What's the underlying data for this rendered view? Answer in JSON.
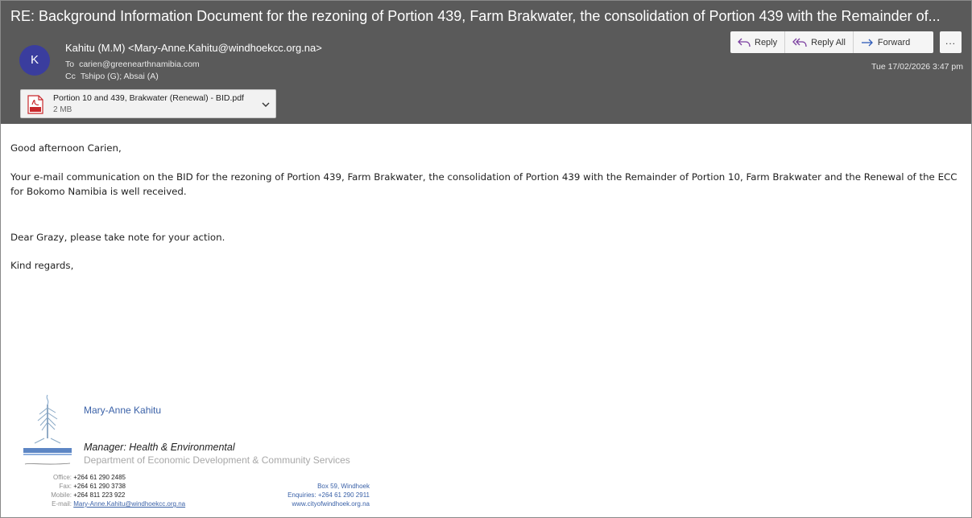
{
  "email": {
    "subject": "RE: Background Information Document for the rezoning of Portion 439, Farm Brakwater, the consolidation of Portion 439 with the Remainder of...",
    "avatar_initial": "K",
    "from": "Kahitu (M.M) <Mary-Anne.Kahitu@windhoekcc.org.na>",
    "to_label": "To",
    "to": "carien@greenearthnamibia.com",
    "cc_label": "Cc",
    "cc": "Tshipo (G); Absai (A)",
    "date": "Tue 17/02/2026 3:47 pm"
  },
  "attachment": {
    "name": "Portion 10 and 439, Brakwater (Renewal) - BID.pdf",
    "size": "2 MB"
  },
  "actions": {
    "reply": "Reply",
    "reply_all": "Reply All",
    "forward": "Forward",
    "more": "..."
  },
  "body": {
    "greeting": "Good afternoon Carien,",
    "paragraph1": "Your e-mail communication on the BID for the rezoning of Portion 439, Farm Brakwater, the consolidation of Portion 439 with the Remainder of Portion 10, Farm Brakwater and the Renewal of the ECC for Bokomo Namibia is well received.",
    "paragraph2": "Dear Grazy, please take note for your action.",
    "closing": "Kind regards,"
  },
  "signature": {
    "name": "Mary-Anne Kahitu",
    "title": "Manager: Health & Environmental",
    "department": "Department of Economic Development & Community Services",
    "office_label": "Office:",
    "office": "+264 61 290 2485",
    "fax_label": "Fax:",
    "fax": "+264 61 290 3738",
    "mobile_label": "Mobile:",
    "mobile": "+264 811 223 922",
    "email_label": "E-mail:",
    "email": "Mary-Anne.Kahitu@windhoekcc.org.na",
    "box": "Box 59, Windhoek",
    "enquiries": "Enquiries: +264 61 290 2911",
    "website": "www.cityofwindhoek.org.na"
  },
  "colors": {
    "header_bg": "#5a5a5a",
    "avatar_bg": "#3a3d9e",
    "link_blue": "#3b62a8",
    "pdf_red": "#c8282c"
  }
}
